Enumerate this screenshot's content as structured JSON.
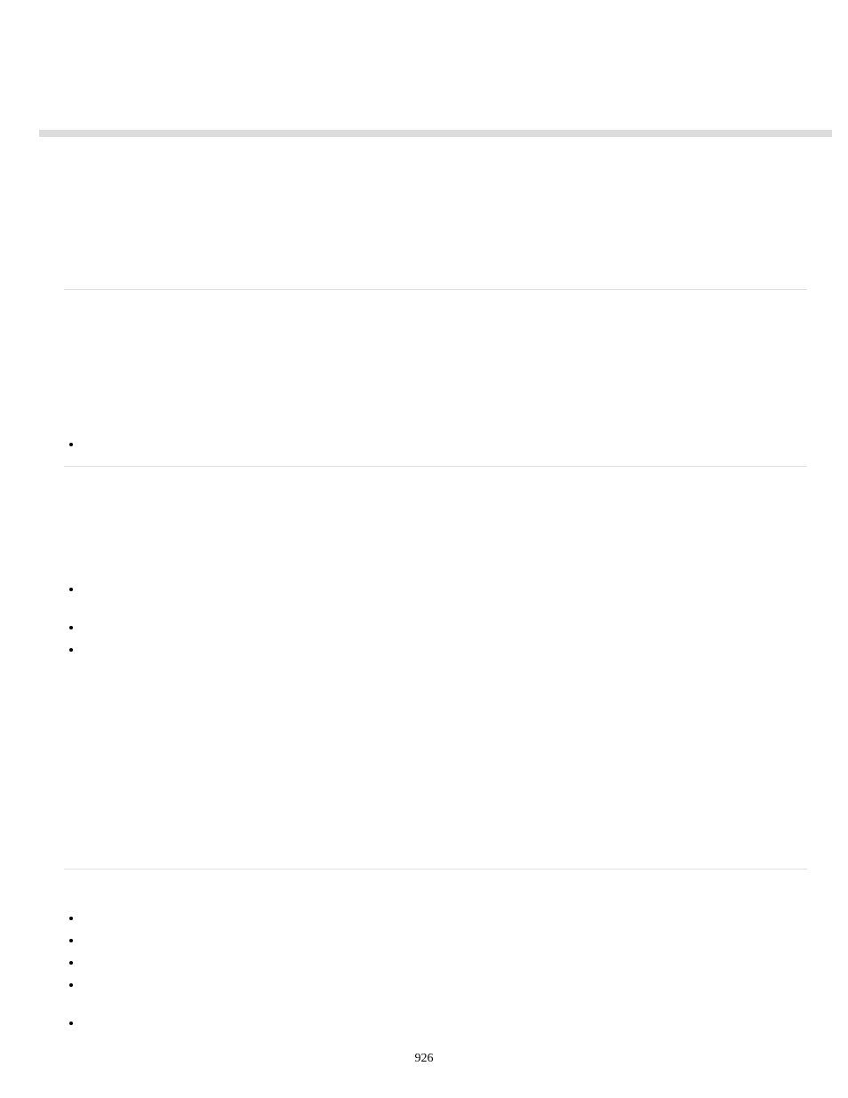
{
  "page_number": "926"
}
